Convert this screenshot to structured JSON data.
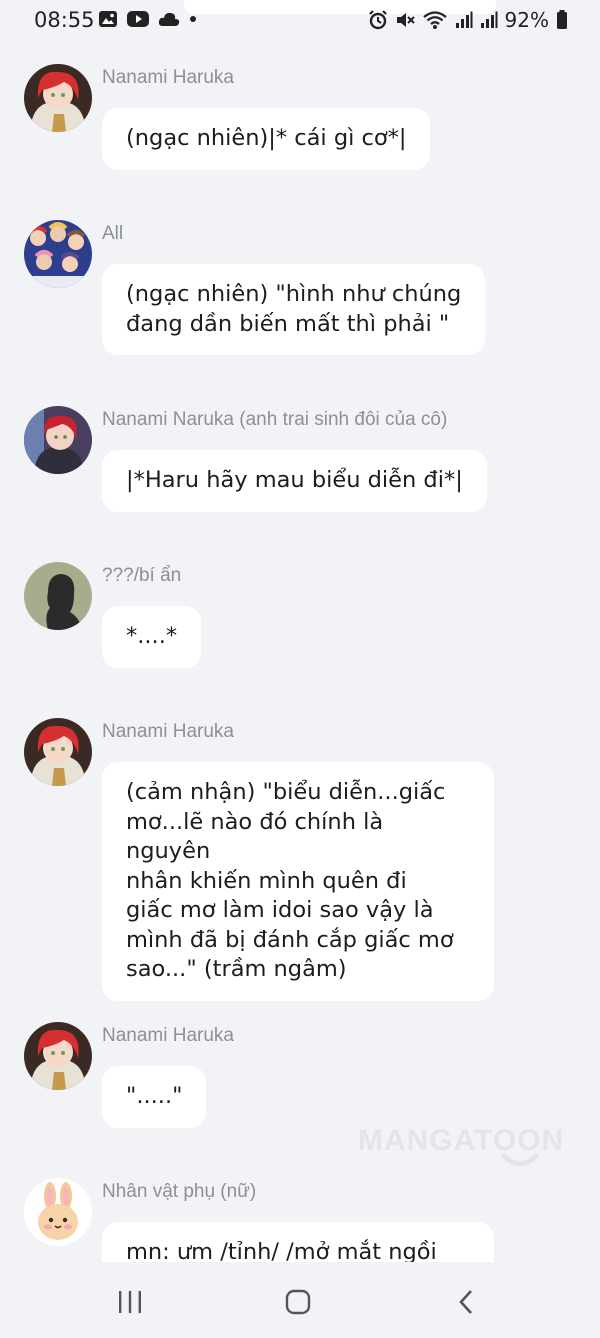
{
  "status_bar": {
    "time": "08:55",
    "battery_percent": "92%",
    "left_icons": [
      "gallery-icon",
      "youtube-icon",
      "cloud-icon",
      "dot-icon"
    ],
    "right_icons": [
      "alarm-icon",
      "mute-icon",
      "wifi-icon",
      "signal-icon",
      "signal-icon",
      "battery-icon"
    ]
  },
  "messages": [
    {
      "sender": "Nanami Haruka",
      "text": "(ngạc nhiên)|* cái gì cơ*|",
      "avatar": "red-hair-girl"
    },
    {
      "sender": "All",
      "text": "(ngạc nhiên) \"hình như chúng\nđang dần biến mất thì phải \"",
      "avatar": "group"
    },
    {
      "sender": "Nanami Naruka (anh trai sinh đôi của cô)",
      "text": "|*Haru hãy mau biểu diễn đi*|",
      "avatar": "red-hair-boy"
    },
    {
      "sender": "???/bí ẩn",
      "text": "*....*",
      "avatar": "silhouette"
    },
    {
      "sender": "Nanami Haruka",
      "text": "(cảm nhận) \"biểu diễn...giấc\nmơ...lẽ nào đó chính là nguyên\nnhân khiến mình quên đi\ngiấc mơ làm idoi sao vậy là\nmình đã bị đánh cắp giấc mơ\nsao...\" (trầm ngâm)",
      "avatar": "red-hair-girl"
    },
    {
      "sender": "Nanami Haruka",
      "text": "\".....\"",
      "avatar": "red-hair-girl"
    },
    {
      "sender": "Nhân vật phụ (nữ)",
      "text": "mn: ưm /tỉnh/ /mở mắt ngồi",
      "avatar": "bunny"
    }
  ],
  "watermark": "MANGATOON",
  "colors": {
    "background": "#f2f3f7",
    "bubble": "#ffffff",
    "sender_text": "#8d8f96",
    "message_text": "#1d1d1f"
  },
  "nav": {
    "recent_icon": "recent-apps-icon",
    "home_icon": "home-icon",
    "back_icon": "back-icon"
  }
}
